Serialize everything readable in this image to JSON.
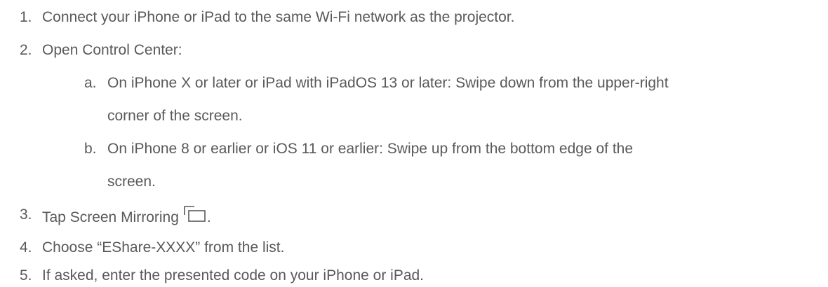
{
  "steps": [
    {
      "num": "1.",
      "text": "Connect your iPhone or iPad to the same Wi-Fi network as the projector."
    },
    {
      "num": "2.",
      "text": "Open Control Center:"
    },
    {
      "num": "3.",
      "text": "Tap Screen Mirroring",
      "suffix": ".",
      "icon": "screen-mirroring-icon"
    },
    {
      "num": "4.",
      "text": "Choose “EShare-XXXX” from the list."
    },
    {
      "num": "5.",
      "text": "If asked, enter the presented code on your iPhone or iPad."
    }
  ],
  "substeps": [
    {
      "letter": "a.",
      "line1": "On iPhone X or later or iPad with iPadOS 13 or later: Swipe down from the upper-right",
      "line2": "corner of the screen."
    },
    {
      "letter": "b.",
      "line1": "On iPhone 8 or earlier or iOS 11 or earlier: Swipe up from the bottom edge of the",
      "line2": "screen."
    }
  ],
  "colors": {
    "text": "#595959"
  }
}
